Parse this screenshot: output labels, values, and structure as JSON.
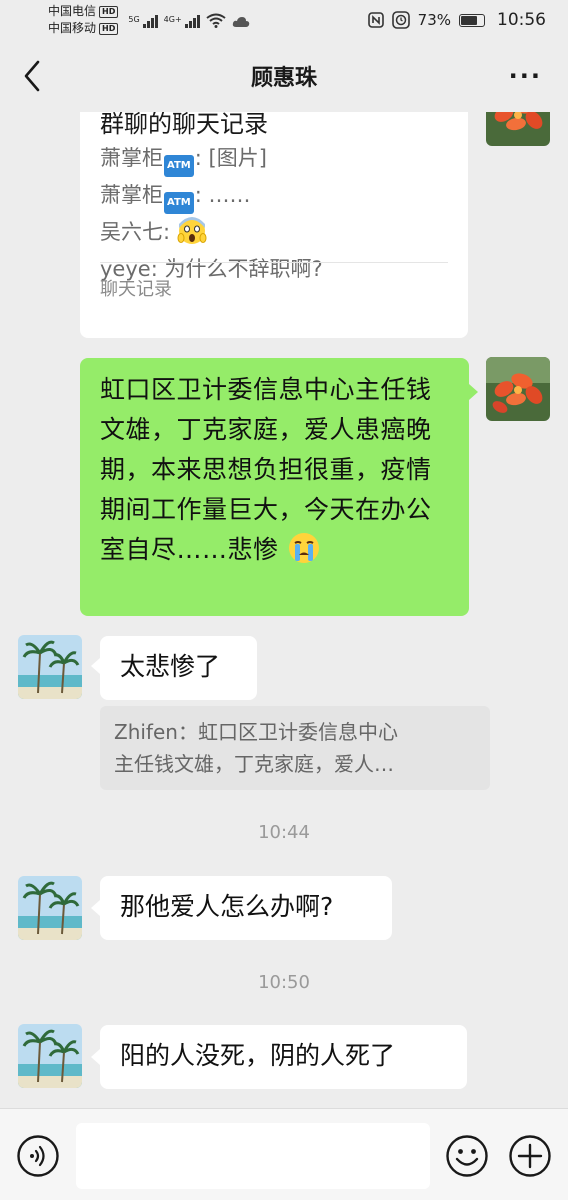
{
  "status_bar": {
    "carrier1": "中国电信",
    "carrier2": "中国移动",
    "hd": "HD",
    "sig1_label": "5G",
    "sig2_label": "4G+",
    "battery_percent_label": "73%",
    "battery_level": 0.73,
    "time": "10:56"
  },
  "header": {
    "title": "顾惠珠"
  },
  "chat_record_card": {
    "title": "群聊的聊天记录",
    "lines": [
      {
        "sender": "萧掌柜",
        "badge": "ATM",
        "text": ": [图片]"
      },
      {
        "sender": "萧掌柜",
        "badge": "ATM",
        "text": ": ……"
      },
      {
        "sender": "吴六七",
        "text": ": "
      },
      {
        "sender": "yeye",
        "text": ": 为什么不辞职啊?"
      }
    ],
    "footer": "聊天记录"
  },
  "messages": {
    "outgoing_1": "虹口区卫计委信息中心主任钱文雄，丁克家庭，爱人患癌晚期，本来思想负担很重，疫情期间工作量巨大，今天在办公室自尽……悲惨",
    "incoming_1": "太悲惨了",
    "quote_line1": "Zhifen：虹口区卫计委信息中心",
    "quote_line2": "主任钱文雄，丁克家庭，爱人…",
    "time_1": "10:44",
    "incoming_2": "那他爱人怎么办啊?",
    "time_2": "10:50",
    "incoming_3": "阳的人没死，阴的人死了"
  },
  "input": {
    "value": ""
  },
  "colors": {
    "chat_bg": "#ededed",
    "outgoing_bubble": "#95ec69",
    "incoming_bubble": "#ffffff"
  }
}
